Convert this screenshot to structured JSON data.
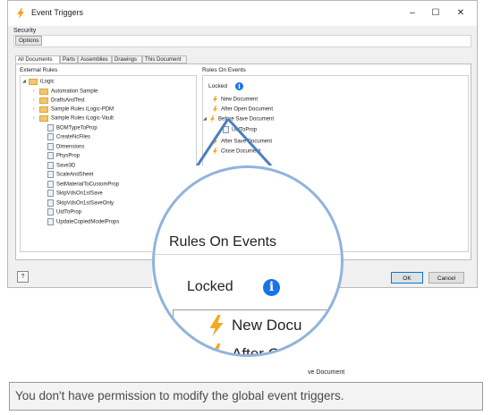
{
  "window": {
    "title": "Event Triggers",
    "minimize": "–",
    "maximize": "☐",
    "close": "✕"
  },
  "security": {
    "label": "Security",
    "options_button": "Options"
  },
  "tabs": [
    "All Documents",
    "Parts",
    "Assemblies",
    "Drawings",
    "This Document"
  ],
  "external_rules": {
    "label": "External Rules",
    "root": "iLogic",
    "folders": [
      "Automation Sample",
      "DraftsAndTest",
      "Sample Rules iLogic-PDM",
      "Sample Rules iLogic-Vault"
    ],
    "rules": [
      "BOMTypeToProp",
      "CreateNcFiles",
      "Dimensions",
      "PhysProp",
      "Save3D",
      "ScaleAndSheet",
      "SetMaterialToCustomProp",
      "SkipVdsOn1stSave",
      "SkipVdsOn1stSaveOnly",
      "UidToProp",
      "UpdateCopiedModelProps"
    ]
  },
  "rules_on_events": {
    "label": "Rules On Events",
    "locked_label": "Locked",
    "info_icon": "i",
    "events": [
      "New Document",
      "After Open Document",
      "Before Save Document",
      "UidToProp",
      "After Save Document",
      "Close Document"
    ]
  },
  "footer": {
    "help": "?",
    "ok": "OK",
    "cancel": "Cancel",
    "partial_label": "D"
  },
  "zoom": {
    "title": "Rules On Events",
    "locked": "Locked",
    "info_icon": "i",
    "item1": "New Docu",
    "item1_overflow": "ment",
    "item2": "After O",
    "item3_partial": "ve Document"
  },
  "tooltip": "You don't have permission to modify the global event triggers.",
  "colors": {
    "accent": "#1a73e8",
    "lens_border": "#8fb4dd",
    "bolt": "#f5a623"
  }
}
